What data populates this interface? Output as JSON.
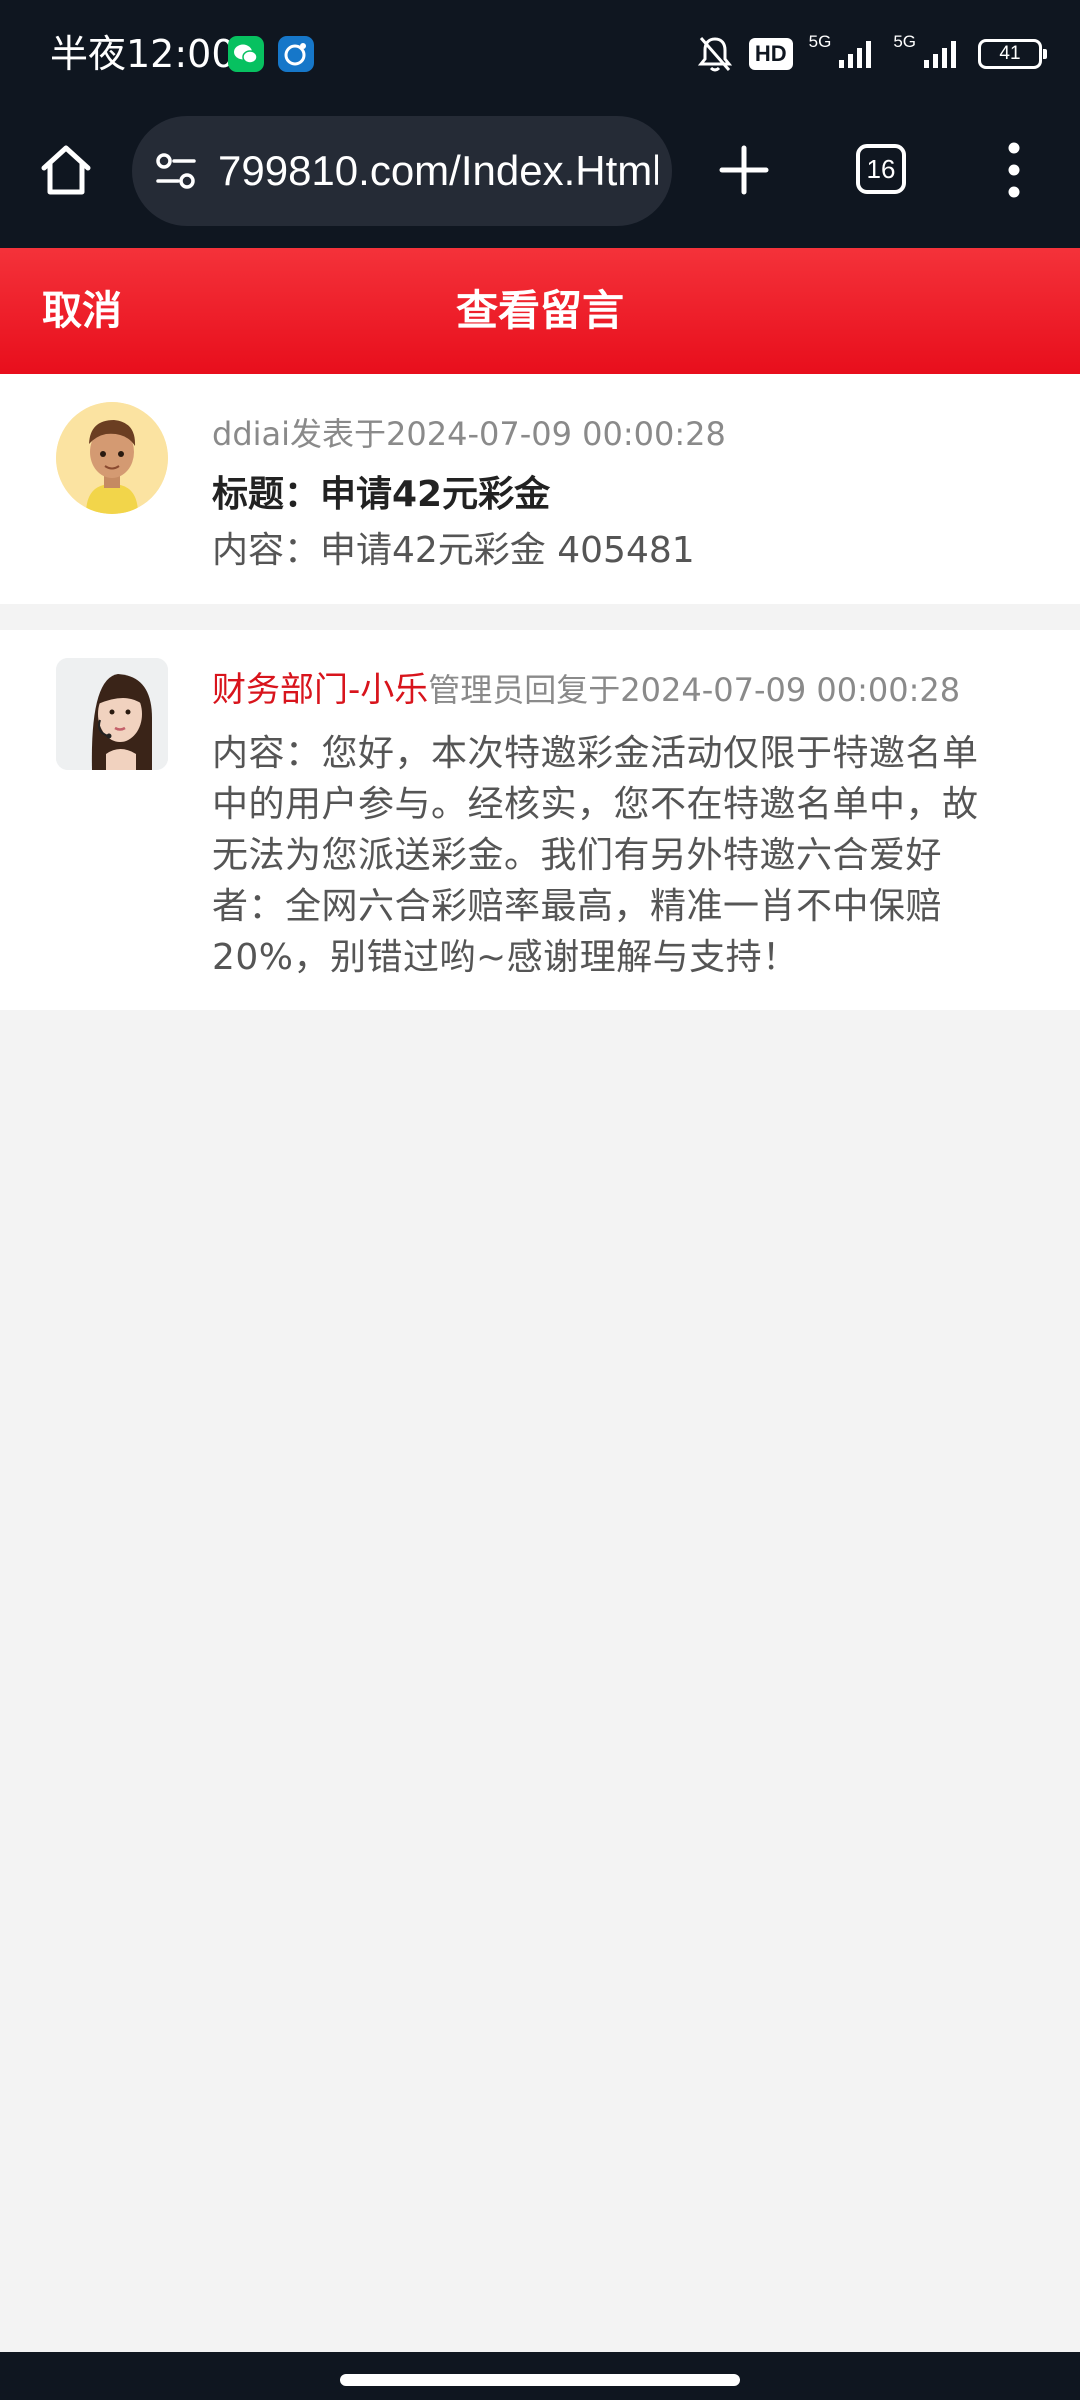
{
  "status_bar": {
    "time": "半夜12:00",
    "hd_label": "HD",
    "network_1": "5G",
    "network_2": "5G",
    "battery": "41"
  },
  "browser": {
    "url": "799810.com/Index.Html",
    "tab_count": "16"
  },
  "header": {
    "cancel_label": "取消",
    "title": "查看留言"
  },
  "messages": [
    {
      "meta": "ddiai发表于2024-07-09 00:00:28",
      "title": "标题：申请42元彩金",
      "content": "内容：申请42元彩金 405481"
    },
    {
      "author": "财务部门-小乐",
      "meta": "管理员回复于2024-07-09 00:00:28",
      "content": "内容：您好，本次特邀彩金活动仅限于特邀名单中的用户参与。经核实，您不在特邀名单中，故无法为您派送彩金。我们有另外特邀六合爱好者：全网六合彩赔率最高，精准一肖不中保赔20%，别错过哟~感谢理解与支持！"
    }
  ],
  "colors": {
    "header_red": "#e80e1c",
    "author_red": "#d8141c",
    "dark_bar": "#0f1620",
    "page_bg": "#f3f3f3"
  },
  "icons": {
    "home": "home-icon",
    "site_info": "site-settings-icon",
    "new_tab": "plus-icon",
    "menu": "more-vert-icon",
    "mute": "bell-off-icon"
  }
}
